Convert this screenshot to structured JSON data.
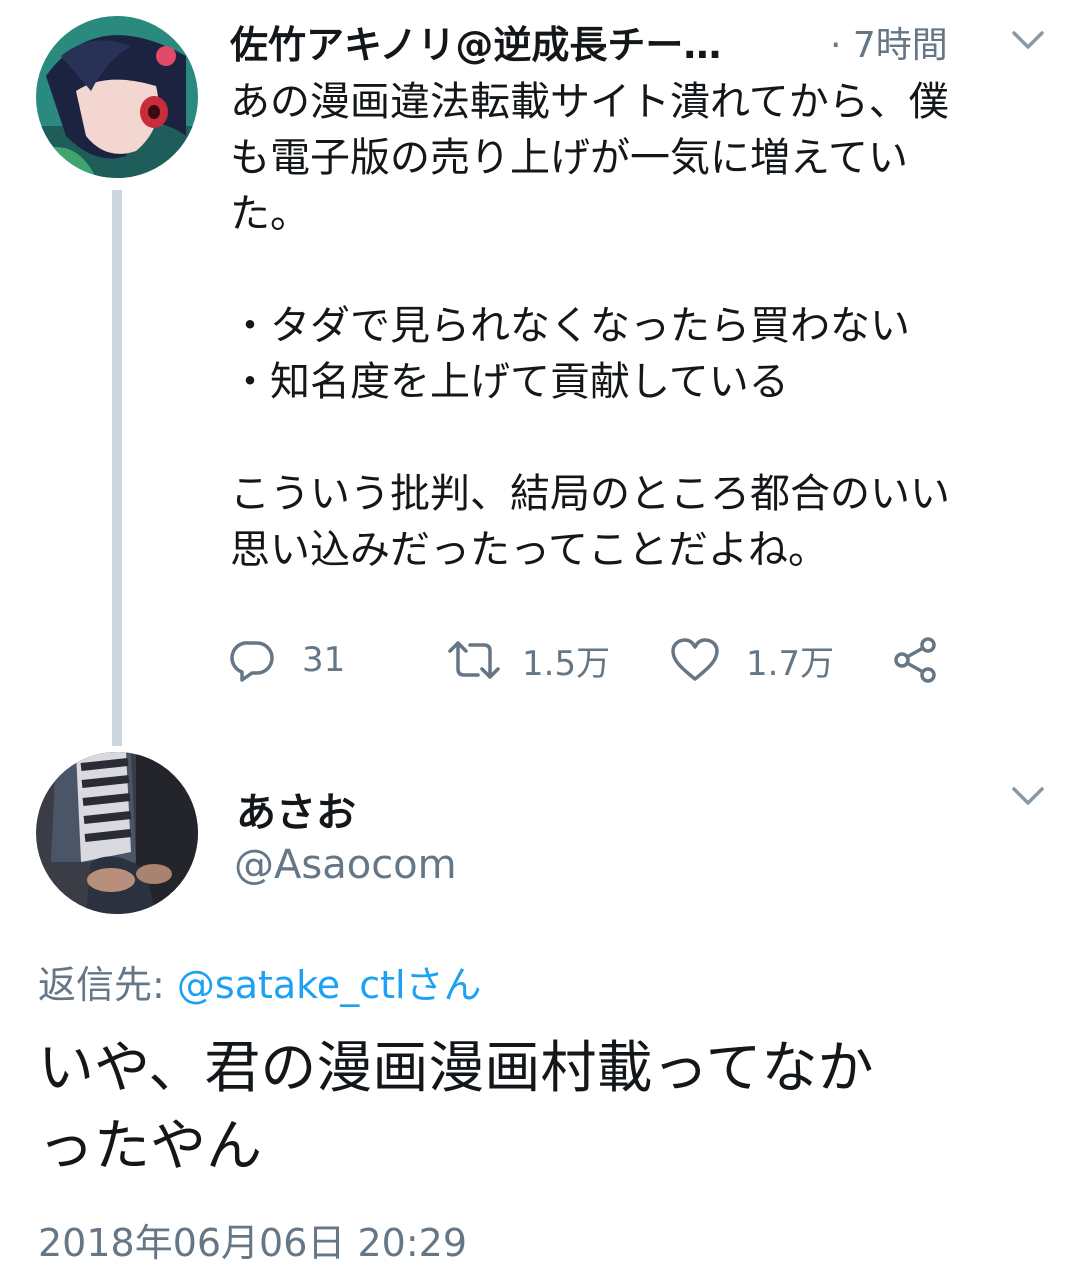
{
  "original_tweet": {
    "author_name": "佐竹アキノリ@逆成長チー…",
    "time_ago": "· 7時間",
    "avatar_icon": "anime-character-avatar",
    "lines": [
      "あの漫画違法転載サイト潰れてから、僕",
      "も電子版の売り上げが一気に増えてい",
      "た。",
      "",
      "・タダで見られなくなったら買わない",
      "・知名度を上げて貢献している",
      "",
      "こういう批判、結局のところ都合のいい",
      "思い込みだったってことだよね。"
    ],
    "actions": {
      "reply_count": "31",
      "retweet_count": "1.5万",
      "like_count": "1.7万"
    }
  },
  "reply_tweet": {
    "author_name": "あさお",
    "handle": "@Asaocom",
    "avatar_icon": "person-photo-avatar",
    "reply_to_label": "返信先: ",
    "reply_to_mention": "@satake_ctlさん",
    "lines": [
      "いや、君の漫画漫画村載ってなか",
      "ったやん"
    ],
    "timestamp": "2018年06月06日 20:29"
  },
  "colors": {
    "text_primary": "#14171a",
    "text_secondary": "#657786",
    "link": "#1da1f2",
    "thread_line": "#ccd6dd"
  }
}
